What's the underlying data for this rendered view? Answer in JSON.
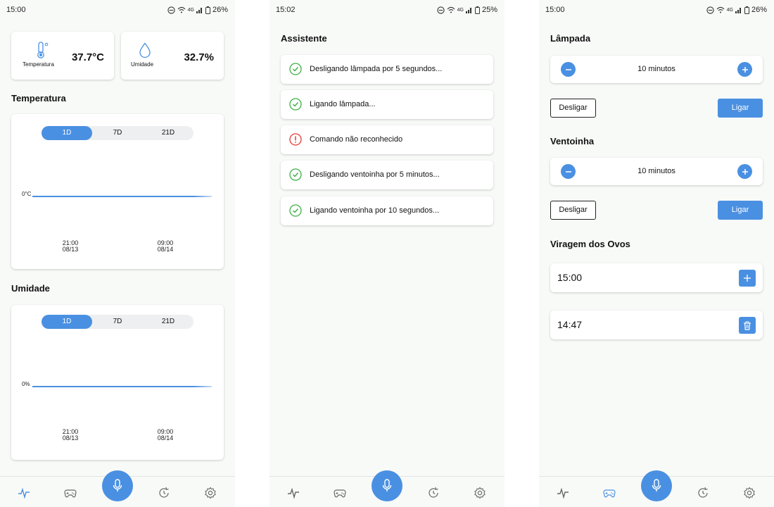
{
  "screen1": {
    "status": {
      "time": "15:00",
      "net": "4G",
      "battery": "26%"
    },
    "metrics": {
      "temperature": {
        "label": "Temperatura",
        "value": "37.7°C",
        "icon": "thermometer-icon"
      },
      "humidity": {
        "label": "Umidade",
        "value": "32.7%",
        "icon": "droplet-icon"
      }
    },
    "temp_section": "Temperatura",
    "hum_section": "Umidade",
    "ranges": [
      "1D",
      "7D",
      "21D"
    ],
    "selected_range": "1D",
    "temp_chart": {
      "y_label": "0°C",
      "ticks": [
        {
          "time": "21:00",
          "date": "08/13"
        },
        {
          "time": "09:00",
          "date": "08/14"
        }
      ]
    },
    "hum_chart": {
      "y_label": "0%",
      "ticks": [
        {
          "time": "21:00",
          "date": "08/13"
        },
        {
          "time": "09:00",
          "date": "08/14"
        }
      ]
    }
  },
  "screen2": {
    "status": {
      "time": "15:02",
      "net": "4G",
      "battery": "25%"
    },
    "title": "Assistente",
    "items": [
      {
        "text": "Desligando lâmpada por 5 segundos...",
        "status": "success"
      },
      {
        "text": "Ligando lâmpada...",
        "status": "success"
      },
      {
        "text": "Comando não reconhecido",
        "status": "error"
      },
      {
        "text": "Desligando ventoinha por 5 minutos...",
        "status": "success"
      },
      {
        "text": "Ligando ventoinha por 10 segundos...",
        "status": "success"
      }
    ]
  },
  "screen3": {
    "status": {
      "time": "15:00",
      "net": "4G",
      "battery": "26%"
    },
    "lamp": {
      "title": "Lâmpada",
      "duration": "10 minutos",
      "off_label": "Desligar",
      "on_label": "Ligar"
    },
    "fan": {
      "title": "Ventoinha",
      "duration": "10 minutos",
      "off_label": "Desligar",
      "on_label": "Ligar"
    },
    "egg_turning": {
      "title": "Viragem dos Ovos",
      "new_time": "15:00",
      "scheduled": [
        "14:47"
      ]
    }
  },
  "nav": {
    "items": [
      "activity-icon",
      "gamepad-icon",
      "microphone-icon",
      "history-icon",
      "settings-icon"
    ],
    "active_by_screen": [
      "activity-icon",
      "none",
      "gamepad-icon"
    ]
  },
  "colors": {
    "accent": "#4a90e2",
    "success": "#3cb043",
    "error": "#e53935",
    "background": "#f8faf8"
  }
}
